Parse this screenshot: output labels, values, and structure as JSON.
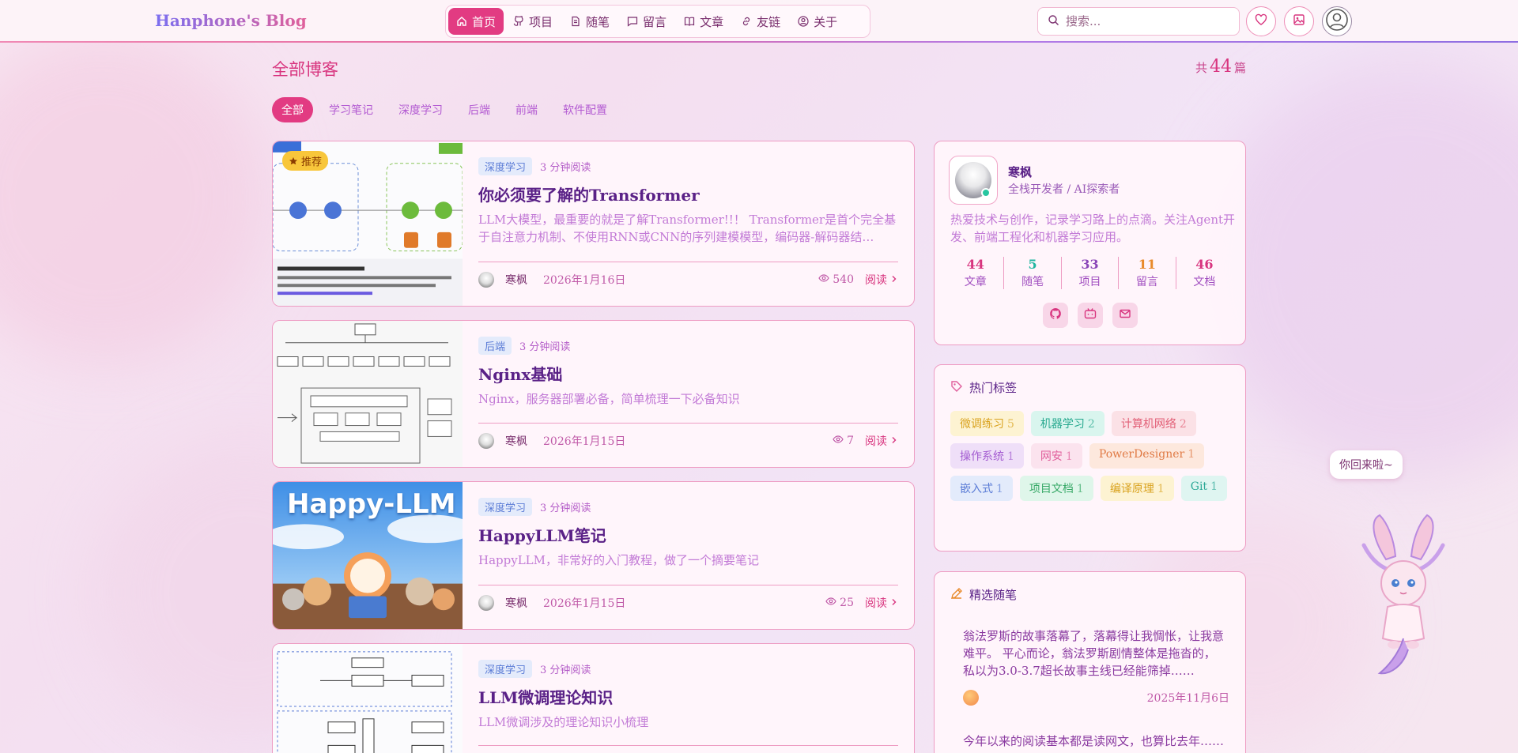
{
  "header": {
    "logo": "Hanphone's Blog",
    "nav": [
      {
        "label": "首页",
        "icon": "home-icon",
        "active": true
      },
      {
        "label": "项目",
        "icon": "github-icon"
      },
      {
        "label": "随笔",
        "icon": "document-icon"
      },
      {
        "label": "留言",
        "icon": "message-icon"
      },
      {
        "label": "文章",
        "icon": "book-icon"
      },
      {
        "label": "友链",
        "icon": "link-icon"
      },
      {
        "label": "关于",
        "icon": "user-icon"
      }
    ],
    "search_placeholder": "搜索..."
  },
  "main": {
    "title": "全部博客",
    "count_prefix": "共",
    "count": "44",
    "count_suffix": "篇",
    "categories": [
      "全部",
      "学习笔记",
      "深度学习",
      "后端",
      "前端",
      "软件配置"
    ]
  },
  "posts": [
    {
      "category": "深度学习",
      "read_time": "3 分钟阅读",
      "recommend": "推荐",
      "title": "你必须要了解的Transformer",
      "excerpt": "LLM大模型，最重要的就是了解Transformer!!！ Transformer是首个完全基于自注意力机制、不使用RNN或CNN的序列建模模型，编码器-解码器结构……",
      "author": "寒枫",
      "date": "2026年1月16日",
      "views": "540",
      "read_label": "阅读"
    },
    {
      "category": "后端",
      "read_time": "3 分钟阅读",
      "title": "Nginx基础",
      "excerpt": "Nginx，服务器部署必备，简单梳理一下必备知识",
      "author": "寒枫",
      "date": "2026年1月15日",
      "views": "7",
      "read_label": "阅读"
    },
    {
      "category": "深度学习",
      "read_time": "3 分钟阅读",
      "title": "HappyLLM笔记",
      "excerpt": "HappyLLM，非常好的入门教程，做了一个摘要笔记",
      "author": "寒枫",
      "date": "2026年1月15日",
      "views": "25",
      "read_label": "阅读",
      "thumb_text": "Happy-LLM"
    },
    {
      "category": "深度学习",
      "read_time": "3 分钟阅读",
      "title": "LLM微调理论知识",
      "excerpt": "LLM微调涉及的理论知识小梳理"
    }
  ],
  "profile": {
    "name": "寒枫",
    "role": "全栈开发者 / AI探索者",
    "bio": "热爱技术与创作，记录学习路上的点滴。关注Agent开发、前端工程化和机器学习应用。",
    "stats": [
      {
        "value": "44",
        "label": "文章",
        "color": "#d8357f"
      },
      {
        "value": "5",
        "label": "随笔",
        "color": "#1fb6a0"
      },
      {
        "value": "33",
        "label": "项目",
        "color": "#8b46b8"
      },
      {
        "value": "11",
        "label": "留言",
        "color": "#e88a2a"
      },
      {
        "value": "46",
        "label": "文档",
        "color": "#d8357f"
      }
    ]
  },
  "hot_tags": {
    "title": "热门标签",
    "tags": [
      {
        "name": "微调练习",
        "count": "5",
        "bg": "#fdf3d2",
        "fg": "#d9a21e"
      },
      {
        "name": "机器学习",
        "count": "2",
        "bg": "#d9f5ee",
        "fg": "#26a88e"
      },
      {
        "name": "计算机网络",
        "count": "2",
        "bg": "#fbe1e6",
        "fg": "#e26077"
      },
      {
        "name": "操作系统",
        "count": "1",
        "bg": "#efdff8",
        "fg": "#a35bd1"
      },
      {
        "name": "网安",
        "count": "1",
        "bg": "#fbe3ee",
        "fg": "#e05e9b"
      },
      {
        "name": "PowerDesigner",
        "count": "1",
        "bg": "#fde8dd",
        "fg": "#e07a45"
      },
      {
        "name": "嵌入式",
        "count": "1",
        "bg": "#e3ebfb",
        "fg": "#5a7bd6"
      },
      {
        "name": "项目文档",
        "count": "1",
        "bg": "#dff6ea",
        "fg": "#36a866"
      },
      {
        "name": "编译原理",
        "count": "1",
        "bg": "#fdf3d2",
        "fg": "#d9a21e"
      },
      {
        "name": "Git",
        "count": "1",
        "bg": "#dff5f1",
        "fg": "#2ba896"
      }
    ]
  },
  "essays": {
    "title": "精选随笔",
    "items": [
      {
        "text": "翁法罗斯的故事落幕了，落幕得让我惆怅，让我意难平。 平心而论，翁法罗斯剧情整体是拖沓的，私以为3.0-3.7超长故事主线已经能筛掉……",
        "date": "2025年11月6日"
      },
      {
        "text": "今年以来的阅读基本都是读网文，也算比去年……"
      }
    ]
  },
  "mascot": {
    "bubble": "你回来啦~"
  }
}
